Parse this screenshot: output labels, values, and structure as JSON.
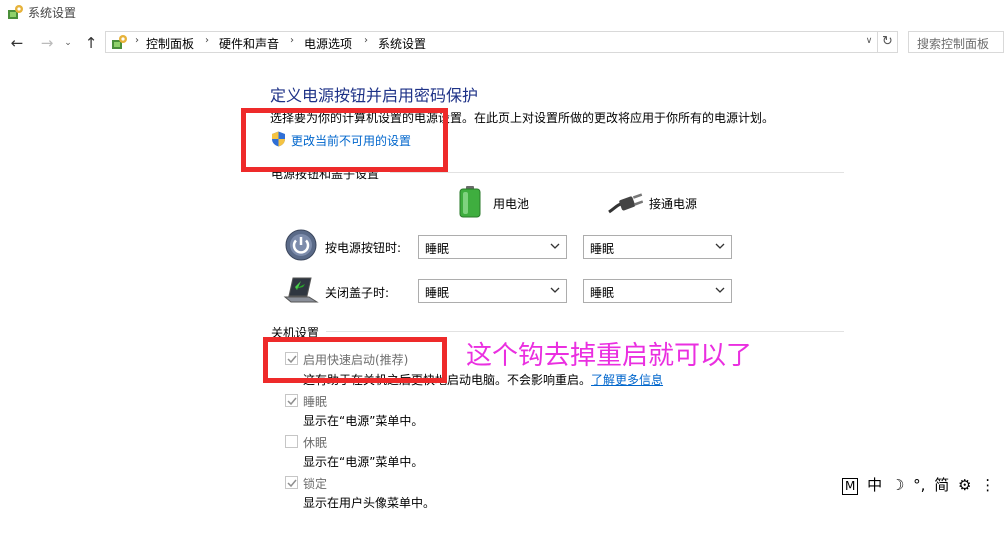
{
  "window": {
    "title": "系统设置"
  },
  "address": {
    "crumbs": [
      "控制面板",
      "硬件和声音",
      "电源选项",
      "系统设置"
    ]
  },
  "search": {
    "placeholder": "搜索控制面板"
  },
  "page": {
    "heading": "定义电源按钮并启用密码保护",
    "description": "选择要为你的计算机设置的电源设置。在此页上对设置所做的更改将应用于你所有的电源计划。",
    "change_link": "更改当前不可用的设置"
  },
  "buttons_section": {
    "title": "电源按钮和盖子设置",
    "columns": [
      "用电池",
      "接通电源"
    ],
    "rows": [
      {
        "label": "按电源按钮时:",
        "battery": "睡眠",
        "plugged": "睡眠"
      },
      {
        "label": "关闭盖子时:",
        "battery": "睡眠",
        "plugged": "睡眠"
      }
    ]
  },
  "shutdown_section": {
    "title": "关机设置",
    "items": [
      {
        "label": "启用快速启动(推荐)",
        "checked": true,
        "desc": "这有助于在关机之后更快地启动电脑。不会影响重启。",
        "link": "了解更多信息"
      },
      {
        "label": "睡眠",
        "checked": true,
        "desc": "显示在“电源”菜单中。"
      },
      {
        "label": "休眠",
        "checked": false,
        "desc": "显示在“电源”菜单中。"
      },
      {
        "label": "锁定",
        "checked": true,
        "desc": "显示在用户头像菜单中。"
      }
    ]
  },
  "annotation": {
    "text": "这个钩去掉重启就可以了",
    "box_color": "#ee2a2a",
    "text_color": "#ea2fe0"
  },
  "ime_bar": {
    "items": [
      "M",
      "中",
      "☽",
      "°,",
      "简",
      "⚙",
      "⋮"
    ]
  },
  "colors": {
    "heading": "#1e3287",
    "link": "#0066cc",
    "disabled_text": "#6d6d6d"
  }
}
